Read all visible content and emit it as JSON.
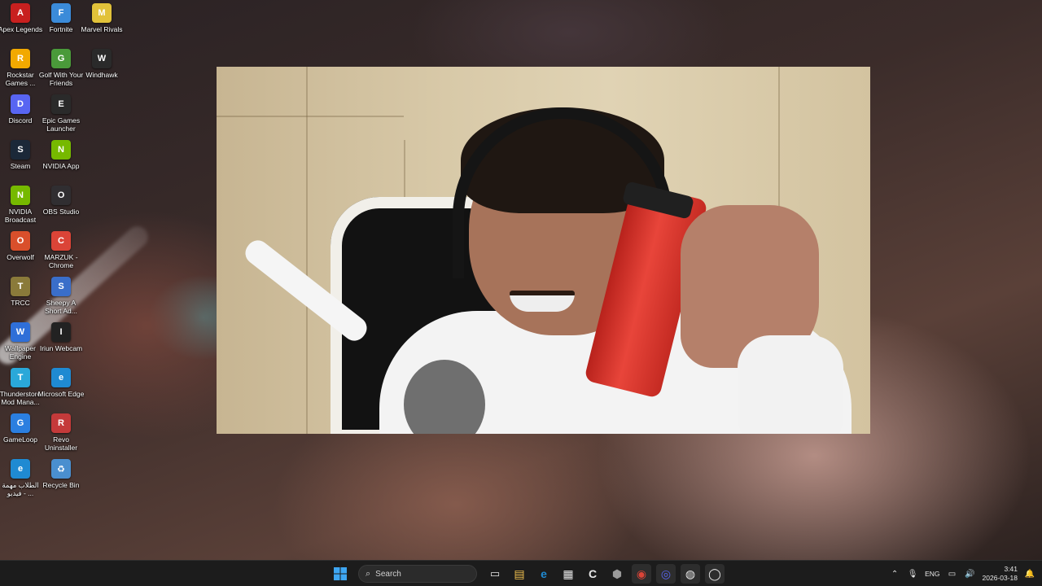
{
  "desktop": {
    "icons": [
      {
        "label": "Apex Legends",
        "glyph": "A",
        "color": "#c8201f",
        "icon": "apex-legends-icon"
      },
      {
        "label": "Fortnite",
        "glyph": "F",
        "color": "#3b8bd9",
        "icon": "fortnite-icon"
      },
      {
        "label": "Marvel Rivals",
        "glyph": "M",
        "color": "#e2c23a",
        "icon": "marvel-rivals-icon"
      },
      {
        "label": "Rockstar Games ...",
        "glyph": "R",
        "color": "#f2a900",
        "icon": "rockstar-games-icon"
      },
      {
        "label": "Golf With Your Friends",
        "glyph": "G",
        "color": "#4a9a3a",
        "icon": "golf-with-your-friends-icon"
      },
      {
        "label": "Windhawk",
        "glyph": "W",
        "color": "#2a2a2a",
        "icon": "windhawk-icon"
      },
      {
        "label": "Discord",
        "glyph": "D",
        "color": "#5865f2",
        "icon": "discord-icon"
      },
      {
        "label": "Epic Games Launcher",
        "glyph": "E",
        "color": "#2a2a2a",
        "icon": "epic-games-launcher-icon"
      },
      {
        "label": "Steam",
        "glyph": "S",
        "color": "#1b2838",
        "icon": "steam-icon"
      },
      {
        "label": "NVIDIA App",
        "glyph": "N",
        "color": "#76b900",
        "icon": "nvidia-app-icon"
      },
      {
        "label": "NVIDIA Broadcast",
        "glyph": "N",
        "color": "#76b900",
        "icon": "nvidia-broadcast-icon"
      },
      {
        "label": "OBS Studio",
        "glyph": "O",
        "color": "#302e31",
        "icon": "obs-studio-icon"
      },
      {
        "label": "Overwolf",
        "glyph": "O",
        "color": "#d94f2b",
        "icon": "overwolf-icon"
      },
      {
        "label": "MARZUK - Chrome",
        "glyph": "C",
        "color": "#db4437",
        "icon": "chrome-icon"
      },
      {
        "label": "TRCC",
        "glyph": "T",
        "color": "#8a7a3a",
        "icon": "trcc-icon"
      },
      {
        "label": "Sheepy A Short Ad...",
        "glyph": "S",
        "color": "#3a6ec9",
        "icon": "sheepy-icon"
      },
      {
        "label": "Wallpaper Engine",
        "glyph": "W",
        "color": "#2f6fd8",
        "icon": "wallpaper-engine-icon"
      },
      {
        "label": "Iriun Webcam",
        "glyph": "I",
        "color": "#222222",
        "icon": "iriun-webcam-icon"
      },
      {
        "label": "Thunderstore Mod Mana...",
        "glyph": "T",
        "color": "#2aa8d9",
        "icon": "thunderstore-icon"
      },
      {
        "label": "Microsoft Edge",
        "glyph": "e",
        "color": "#1f8ad2",
        "icon": "edge-icon"
      },
      {
        "label": "GameLoop",
        "glyph": "G",
        "color": "#2b7fe0",
        "icon": "gameloop-icon"
      },
      {
        "label": "Revo Uninstaller",
        "glyph": "R",
        "color": "#c43a3a",
        "icon": "revo-uninstaller-icon"
      },
      {
        "label": "الطلاب مهمة فيديو - ...",
        "glyph": "e",
        "color": "#1f8ad2",
        "icon": "edge-shortcut-icon"
      },
      {
        "label": "Recycle Bin",
        "glyph": "♻",
        "color": "#4a8fcf",
        "icon": "recycle-bin-icon"
      }
    ]
  },
  "taskbar": {
    "search_placeholder": "Search",
    "apps": [
      {
        "icon": "file-explorer-icon",
        "glyph": "▤",
        "color": "#f2c14e",
        "active": false
      },
      {
        "icon": "edge-icon",
        "glyph": "e",
        "color": "#1f8ad2",
        "active": false
      },
      {
        "icon": "microsoft-store-icon",
        "glyph": "▦",
        "color": "#e8e8e8",
        "active": false
      },
      {
        "icon": "ctrl-app-icon",
        "glyph": "C",
        "color": "#e8e8e8",
        "active": false
      },
      {
        "icon": "app-hex-icon",
        "glyph": "⬢",
        "color": "#9a9a9a",
        "active": false
      },
      {
        "icon": "chrome-icon",
        "glyph": "◉",
        "color": "#db4437",
        "active": true
      },
      {
        "icon": "discord-icon",
        "glyph": "◎",
        "color": "#5865f2",
        "active": true
      },
      {
        "icon": "obs-studio-icon",
        "glyph": "◍",
        "color": "#e8e8e8",
        "active": true
      },
      {
        "icon": "iriun-webcam-icon",
        "glyph": "◯",
        "color": "#e8e8e8",
        "active": true
      }
    ],
    "tray": {
      "language": "ENG",
      "time": "3:41",
      "date": "2026-03-18"
    }
  }
}
